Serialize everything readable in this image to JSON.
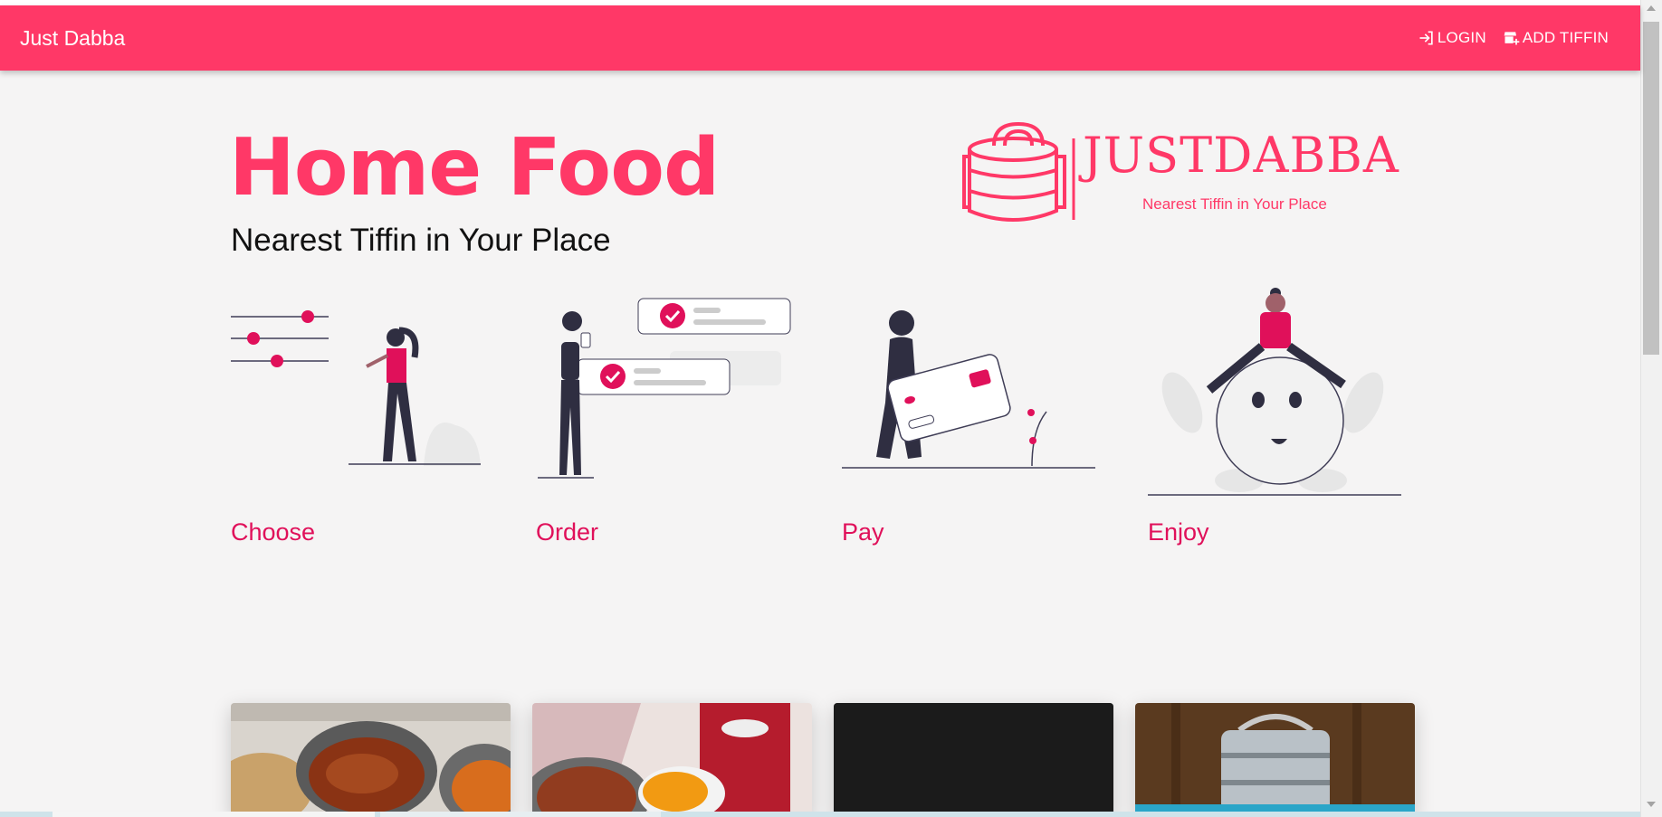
{
  "appbar": {
    "brand": "Just Dabba",
    "login_label": "LOGIN",
    "add_tiffin_label": "ADD TIFFIN",
    "login_icon": "login-icon",
    "add_tiffin_icon": "add-store-icon"
  },
  "hero": {
    "title": "Home Food",
    "subtitle": "Nearest Tiffin in Your Place"
  },
  "logo": {
    "wordmark": "JUSTDABBA",
    "tagline": "Nearest Tiffin in Your Place"
  },
  "steps": [
    {
      "label": "Choose",
      "illustration": "slider-filter-illustration"
    },
    {
      "label": "Order",
      "illustration": "checklist-order-illustration"
    },
    {
      "label": "Pay",
      "illustration": "credit-card-illustration"
    },
    {
      "label": "Enjoy",
      "illustration": "happy-person-illustration"
    }
  ],
  "cards": [
    {
      "image": "curry-tiffin-photo"
    },
    {
      "image": "orange-lunchbox-photo"
    },
    {
      "image": "dark-photo"
    },
    {
      "image": "steel-tiffin-photo"
    }
  ],
  "colors": {
    "accent": "#ff3867",
    "step_label": "#e0105a",
    "background": "#f5f4f4"
  }
}
